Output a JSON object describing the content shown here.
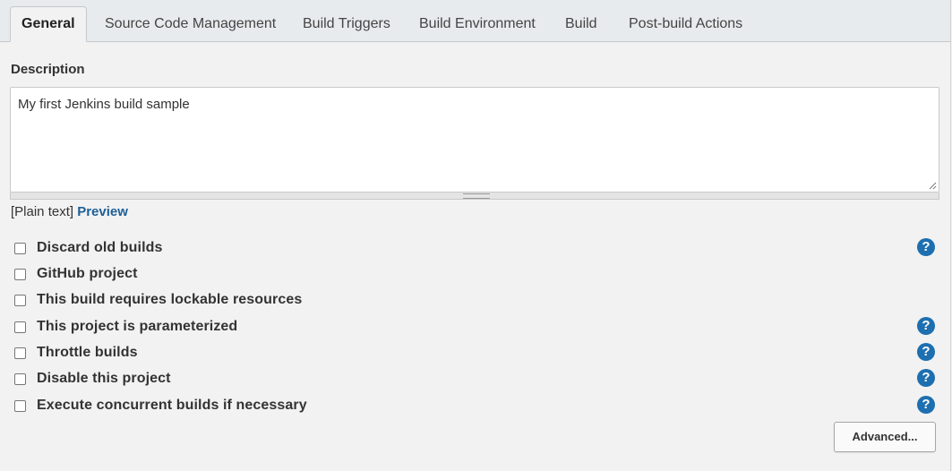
{
  "tabs": [
    {
      "label": "General",
      "active": true
    },
    {
      "label": "Source Code Management"
    },
    {
      "label": "Build Triggers"
    },
    {
      "label": "Build Environment"
    },
    {
      "label": "Build"
    },
    {
      "label": "Post-build Actions"
    }
  ],
  "description": {
    "label": "Description",
    "value": "My first Jenkins build sample",
    "format_text": "[Plain text]",
    "preview_link": "Preview"
  },
  "options": [
    {
      "label": "Discard old builds",
      "checked": false,
      "help": true
    },
    {
      "label": "GitHub project",
      "checked": false,
      "help": false
    },
    {
      "label": "This build requires lockable resources",
      "checked": false,
      "help": false
    },
    {
      "label": "This project is parameterized",
      "checked": false,
      "help": true
    },
    {
      "label": "Throttle builds",
      "checked": false,
      "help": true
    },
    {
      "label": "Disable this project",
      "checked": false,
      "help": true
    },
    {
      "label": "Execute concurrent builds if necessary",
      "checked": false,
      "help": true
    }
  ],
  "help_icon_glyph": "?",
  "advanced_button": "Advanced...",
  "colors": {
    "link": "#1d5f96",
    "help_icon": "#1d6fb0",
    "tabbar_bg": "#e8ebed",
    "page_bg": "#f2f2f2"
  }
}
